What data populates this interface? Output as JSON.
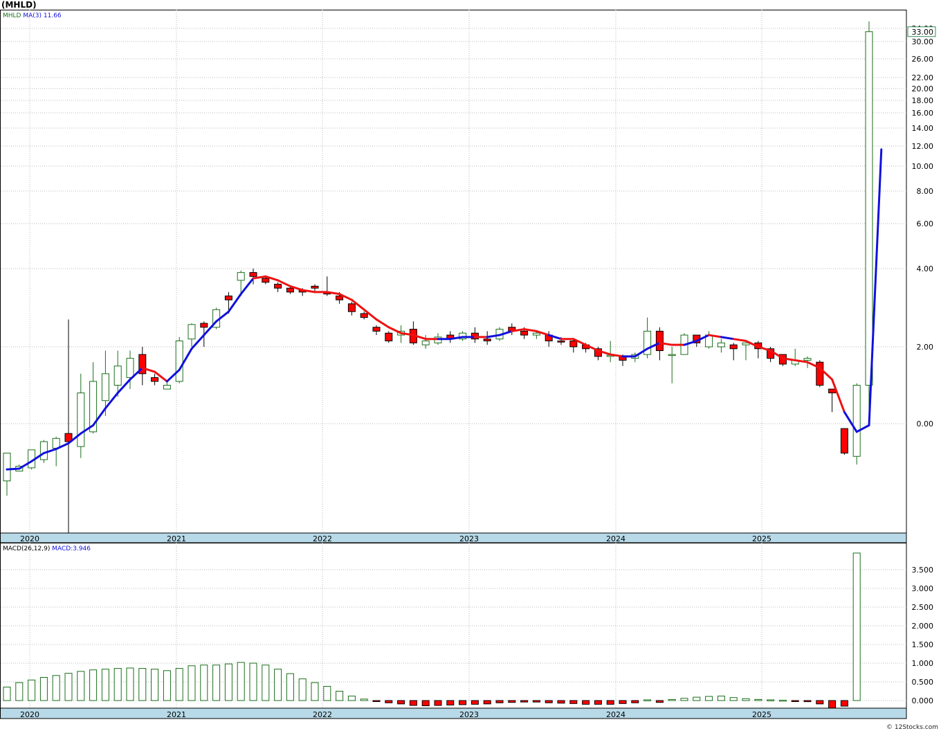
{
  "title": "(MHLD)",
  "footer": "© 12Stocks.com",
  "colors": {
    "up_candle": "#1a6e1a",
    "down_candle": "#ff0000",
    "ma_rising": "#1010dd",
    "ma_falling": "#ee1111",
    "grid": "#b8b8b8",
    "date_bar": "#b7d9e8",
    "price_box": "#2e8b57"
  },
  "chart_data": [
    {
      "type": "candlestick",
      "scale": "log",
      "legend": {
        "symbol": "MHLD",
        "indicator": "MA(3)",
        "value": "11.66"
      },
      "last_price_label": "33.00",
      "y_tick_labels": [
        "34.00",
        "30.00",
        "26.00",
        "22.00",
        "20.00",
        "18.00",
        "16.00",
        "14.00",
        "12.00",
        "10.00",
        "8.00",
        "6.00",
        "4.00",
        "2.00",
        "0.00"
      ],
      "x_tick_labels": [
        "2020",
        "2021",
        "2022",
        "2023",
        "2024",
        "2025"
      ],
      "grid": true,
      "candles": [
        [
          -3.5,
          -1.8,
          -4.4,
          -2.8
        ],
        [
          -2.9,
          -2.6,
          -2.5,
          -2.9
        ],
        [
          -2.7,
          -1.6,
          -1.6,
          -2.8
        ],
        [
          -2.2,
          -1.1,
          -1.0,
          -2.4
        ],
        [
          -1.5,
          -0.9,
          -0.8,
          -2.6
        ],
        [
          -0.6,
          -1.1,
          2.7,
          -12.0
        ],
        [
          -1.4,
          0.8,
          1.3,
          -2.1
        ],
        [
          -0.5,
          1.1,
          1.6,
          -0.6
        ],
        [
          0.6,
          1.3,
          1.9,
          0.2
        ],
        [
          1.0,
          1.5,
          1.9,
          0.7
        ],
        [
          1.2,
          1.7,
          1.9,
          0.9
        ],
        [
          1.8,
          1.3,
          2.0,
          1.0
        ],
        [
          1.2,
          1.1,
          1.3,
          1.0
        ],
        [
          0.9,
          1.0,
          1.1,
          0.9
        ],
        [
          1.1,
          2.15,
          2.25,
          1.05
        ],
        [
          2.2,
          2.57,
          2.6,
          2.0
        ],
        [
          2.6,
          2.5,
          2.65,
          2.0
        ],
        [
          2.5,
          2.95,
          3.0,
          2.45
        ],
        [
          3.3,
          3.2,
          3.4,
          2.85
        ],
        [
          3.7,
          3.9,
          3.95,
          3.3
        ],
        [
          3.9,
          3.8,
          4.0,
          3.6
        ],
        [
          3.75,
          3.65,
          3.8,
          3.6
        ],
        [
          3.6,
          3.5,
          3.65,
          3.4
        ],
        [
          3.5,
          3.4,
          3.55,
          3.35
        ],
        [
          3.45,
          3.4,
          3.5,
          3.3
        ],
        [
          3.55,
          3.5,
          3.6,
          3.4
        ],
        [
          3.4,
          3.35,
          3.8,
          3.3
        ],
        [
          3.3,
          3.2,
          3.4,
          3.1
        ],
        [
          3.1,
          2.9,
          3.15,
          2.8
        ],
        [
          2.85,
          2.75,
          2.9,
          2.7
        ],
        [
          2.5,
          2.4,
          2.55,
          2.3
        ],
        [
          2.35,
          2.15,
          2.4,
          2.1
        ],
        [
          2.3,
          2.4,
          2.55,
          2.1
        ],
        [
          2.45,
          2.1,
          2.65,
          2.05
        ],
        [
          2.05,
          2.15,
          2.3,
          1.95
        ],
        [
          2.1,
          2.25,
          2.35,
          2.05
        ],
        [
          2.3,
          2.2,
          2.4,
          2.1
        ],
        [
          2.2,
          2.35,
          2.4,
          2.15
        ],
        [
          2.35,
          2.2,
          2.5,
          2.1
        ],
        [
          2.2,
          2.15,
          2.4,
          2.05
        ],
        [
          2.2,
          2.45,
          2.5,
          2.15
        ],
        [
          2.5,
          2.4,
          2.6,
          2.3
        ],
        [
          2.4,
          2.3,
          2.5,
          2.2
        ],
        [
          2.3,
          2.35,
          2.4,
          2.2
        ],
        [
          2.3,
          2.15,
          2.4,
          2.0
        ],
        [
          2.15,
          2.12,
          2.25,
          2.05
        ],
        [
          2.15,
          2.0,
          2.2,
          1.85
        ],
        [
          2.05,
          1.95,
          2.1,
          1.85
        ],
        [
          1.95,
          1.75,
          2.0,
          1.65
        ],
        [
          1.75,
          1.78,
          2.15,
          1.6
        ],
        [
          1.75,
          1.65,
          1.8,
          1.5
        ],
        [
          1.7,
          1.8,
          1.85,
          1.6
        ],
        [
          1.8,
          2.4,
          2.75,
          1.7
        ],
        [
          2.4,
          1.9,
          2.5,
          1.65
        ],
        [
          1.8,
          1.8,
          2.0,
          1.05
        ],
        [
          1.8,
          2.3,
          2.35,
          1.8
        ],
        [
          2.3,
          2.1,
          2.3,
          2.0
        ],
        [
          2.0,
          2.3,
          2.4,
          1.95
        ],
        [
          2.0,
          2.1,
          2.2,
          1.85
        ],
        [
          2.05,
          1.95,
          2.1,
          1.65
        ],
        [
          2.05,
          2.1,
          2.1,
          1.65
        ],
        [
          2.1,
          1.95,
          2.15,
          1.7
        ],
        [
          1.95,
          1.7,
          2.0,
          1.6
        ],
        [
          1.8,
          1.55,
          1.8,
          1.5
        ],
        [
          1.55,
          1.65,
          1.95,
          1.5
        ],
        [
          1.65,
          1.7,
          1.75,
          1.45
        ],
        [
          1.6,
          1.0,
          1.65,
          0.95
        ],
        [
          0.9,
          0.8,
          0.9,
          0.3
        ],
        [
          -0.3,
          -1.8,
          -1.1,
          -1.9
        ],
        [
          -2.0,
          1.0,
          1.05,
          -2.5
        ],
        [
          1.0,
          33.0,
          35.5,
          0.0
        ]
      ],
      "ma": [
        -2.8,
        -2.75,
        -2.3,
        -1.8,
        -1.55,
        -1.2,
        -0.6,
        -0.1,
        0.4,
        0.8,
        1.15,
        1.45,
        1.35,
        1.1,
        1.4,
        1.95,
        2.3,
        2.65,
        2.9,
        3.35,
        3.75,
        3.8,
        3.7,
        3.55,
        3.45,
        3.4,
        3.4,
        3.35,
        3.2,
        2.95,
        2.7,
        2.5,
        2.35,
        2.3,
        2.2,
        2.2,
        2.2,
        2.25,
        2.25,
        2.25,
        2.3,
        2.4,
        2.45,
        2.4,
        2.3,
        2.2,
        2.2,
        2.05,
        1.9,
        1.8,
        1.75,
        1.75,
        1.95,
        2.1,
        2.05,
        2.05,
        2.15,
        2.3,
        2.25,
        2.2,
        2.15,
        2.0,
        1.9,
        1.7,
        1.65,
        1.6,
        1.45,
        1.15,
        0.3,
        -0.5,
        -0.1,
        11.66
      ],
      "ma_color_pattern": [
        "red",
        "blue",
        "blue",
        "blue",
        "blue",
        "blue",
        "blue",
        "blue",
        "blue",
        "blue",
        "blue",
        "blue",
        "red",
        "red",
        "blue",
        "blue",
        "blue",
        "blue",
        "blue",
        "blue",
        "blue",
        "red",
        "red",
        "red",
        "red",
        "red",
        "red",
        "red",
        "red",
        "red",
        "red",
        "red",
        "red",
        "red",
        "red",
        "red",
        "blue",
        "blue",
        "blue",
        "red",
        "blue",
        "blue",
        "red",
        "red",
        "red",
        "blue",
        "red",
        "red",
        "red",
        "red",
        "red",
        "blue",
        "blue",
        "blue",
        "red",
        "red",
        "blue",
        "blue",
        "red",
        "blue",
        "red",
        "red",
        "red",
        "red",
        "red",
        "red",
        "red",
        "red",
        "red",
        "blue",
        "blue",
        "blue"
      ]
    },
    {
      "type": "bar",
      "legend": {
        "indicator": "MACD(26,12,9)",
        "label": "MACD",
        "value": "3.946"
      },
      "y_tick_labels": [
        "3.500",
        "3.000",
        "2.500",
        "2.000",
        "1.500",
        "1.000",
        "0.500",
        "0.000"
      ],
      "ylim": [
        -0.2,
        4.1
      ],
      "grid": true,
      "values": [
        0.36,
        0.48,
        0.55,
        0.62,
        0.67,
        0.73,
        0.78,
        0.82,
        0.84,
        0.86,
        0.87,
        0.86,
        0.84,
        0.8,
        0.86,
        0.93,
        0.95,
        0.95,
        0.98,
        1.02,
        1.0,
        0.95,
        0.84,
        0.72,
        0.58,
        0.48,
        0.38,
        0.25,
        0.12,
        0.04,
        -0.02,
        -0.06,
        -0.09,
        -0.13,
        -0.14,
        -0.13,
        -0.12,
        -0.11,
        -0.1,
        -0.09,
        -0.06,
        -0.05,
        -0.04,
        -0.04,
        -0.06,
        -0.07,
        -0.08,
        -0.1,
        -0.1,
        -0.1,
        -0.08,
        -0.06,
        0.02,
        -0.05,
        0.03,
        0.06,
        0.09,
        0.11,
        0.12,
        0.08,
        0.05,
        0.03,
        0.02,
        0.01,
        -0.02,
        -0.03,
        -0.09,
        -0.2,
        -0.15,
        3.946
      ]
    }
  ]
}
